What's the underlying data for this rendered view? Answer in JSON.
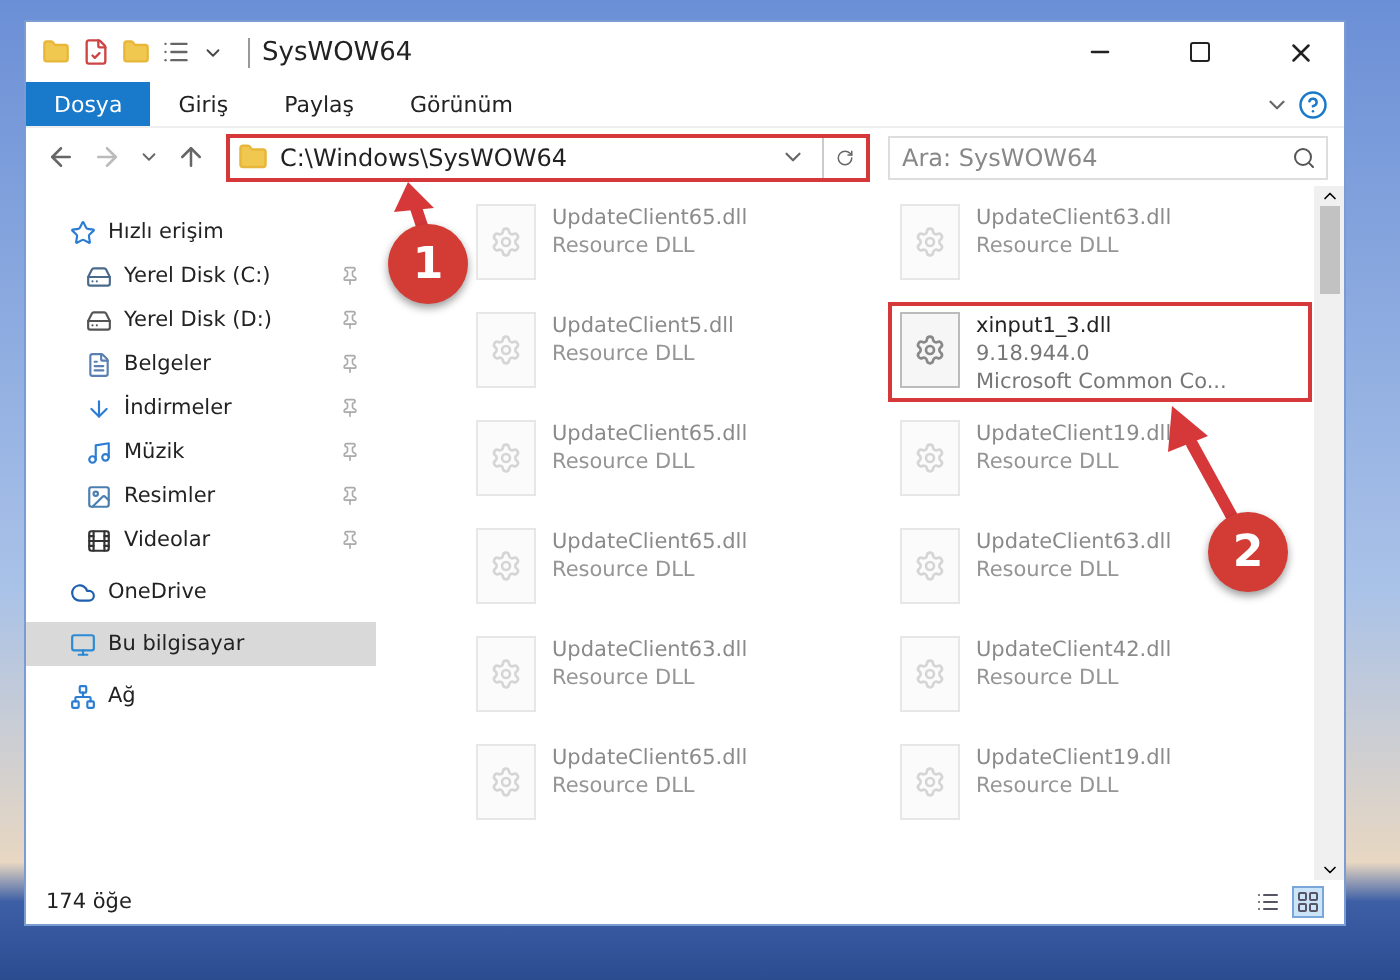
{
  "window": {
    "title": "SysWOW64"
  },
  "ribbon_tabs": [
    {
      "label": "Dosya",
      "selected": true
    },
    {
      "label": "Giriş",
      "selected": false
    },
    {
      "label": "Paylaş",
      "selected": false
    },
    {
      "label": "Görünüm",
      "selected": false
    }
  ],
  "address": {
    "path": "C:\\Windows\\SysWOW64",
    "highlighted": true
  },
  "search": {
    "placeholder": "Ara: SysWOW64"
  },
  "nav": [
    {
      "label": "Hızlı erişim",
      "kind": "header",
      "pinned": false,
      "selected": false
    },
    {
      "label": "Yerel Disk (C:)",
      "kind": "item",
      "pinned": true,
      "selected": false
    },
    {
      "label": "Yerel Disk (D:)",
      "kind": "item",
      "pinned": true,
      "selected": false
    },
    {
      "label": "Belgeler",
      "kind": "item",
      "pinned": true,
      "selected": false
    },
    {
      "label": "İndirmeler",
      "kind": "item",
      "pinned": true,
      "selected": false
    },
    {
      "label": "Müzik",
      "kind": "item",
      "pinned": true,
      "selected": false
    },
    {
      "label": "Resimler",
      "kind": "item",
      "pinned": true,
      "selected": false
    },
    {
      "label": "Videolar",
      "kind": "item",
      "pinned": true,
      "selected": false
    },
    {
      "label": "OneDrive",
      "kind": "header",
      "pinned": false,
      "selected": false
    },
    {
      "label": "Bu bilgisayar",
      "kind": "header",
      "pinned": false,
      "selected": true
    },
    {
      "label": "Ağ",
      "kind": "header",
      "pinned": false,
      "selected": false
    }
  ],
  "files": [
    {
      "name": "UpdateClient65.dll",
      "lines": [
        "Resource DLL"
      ],
      "faded": true,
      "highlighted": false
    },
    {
      "name": "UpdateClient63.dll",
      "lines": [
        "Resource DLL"
      ],
      "faded": true,
      "highlighted": false
    },
    {
      "name": "UpdateClient5.dll",
      "lines": [
        "Resource DLL"
      ],
      "faded": true,
      "highlighted": false
    },
    {
      "name": "xinput1_3.dll",
      "lines": [
        "9.18.944.0",
        "Microsoft Common Co..."
      ],
      "faded": false,
      "highlighted": true
    },
    {
      "name": "UpdateClient65.dll",
      "lines": [
        "Resource DLL"
      ],
      "faded": true,
      "highlighted": false
    },
    {
      "name": "UpdateClient19.dll",
      "lines": [
        "Resource DLL"
      ],
      "faded": true,
      "highlighted": false
    },
    {
      "name": "UpdateClient65.dll",
      "lines": [
        "Resource DLL"
      ],
      "faded": true,
      "highlighted": false
    },
    {
      "name": "UpdateClient63.dll",
      "lines": [
        "Resource DLL"
      ],
      "faded": true,
      "highlighted": false
    },
    {
      "name": "UpdateClient63.dll",
      "lines": [
        "Resource DLL"
      ],
      "faded": true,
      "highlighted": false
    },
    {
      "name": "UpdateClient42.dll",
      "lines": [
        "Resource DLL"
      ],
      "faded": true,
      "highlighted": false
    },
    {
      "name": "UpdateClient65.dll",
      "lines": [
        "Resource DLL"
      ],
      "faded": true,
      "highlighted": false
    },
    {
      "name": "UpdateClient19.dll",
      "lines": [
        "Resource DLL"
      ],
      "faded": true,
      "highlighted": false
    }
  ],
  "status_bar": {
    "count": "174 öğe"
  },
  "view_modes": [
    {
      "selected": false
    },
    {
      "selected": true
    }
  ],
  "annotations": [
    {
      "number": "1"
    },
    {
      "number": "2"
    }
  ]
}
